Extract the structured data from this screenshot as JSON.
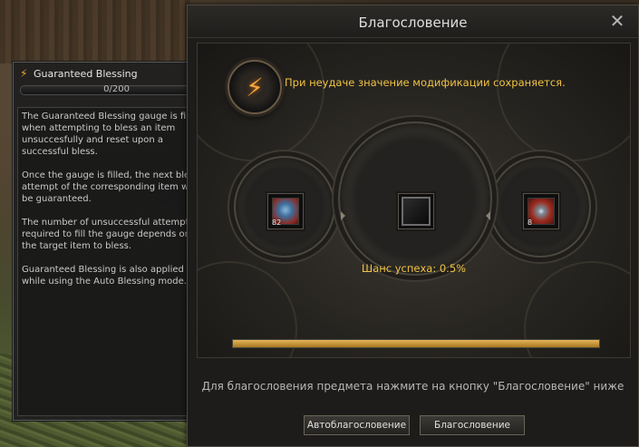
{
  "tooltip": {
    "title": "Guaranteed Blessing",
    "gauge_text": "0/200",
    "gauge_progress": 0,
    "paragraphs": [
      "The Guaranteed Blessing gauge is filled when attempting to bless an item unsuccesfully and reset upon a successful bless.",
      "Once the gauge is filled, the next bless attempt of the corresponding item will be guaranteed.",
      "The number of unsuccessful attempts required to fill the gauge depends on the target item to bless.",
      "Guaranteed Blessing is also applied while using the Auto Blessing mode."
    ]
  },
  "window": {
    "title": "Благословение",
    "close_icon": "close-icon",
    "notice": "При неудаче значение модификации сохраняется.",
    "left_item_count": "82",
    "right_item_count": "8",
    "chance_text": "Шанс успеха: 0.5%",
    "progress": 1.0,
    "instruction": "Для благословения предмета нажмите на кнопку \"Благословение\" ниже",
    "auto_button": "Автоблагословение",
    "bless_button": "Благословение"
  },
  "colors": {
    "accent_gold": "#f0c243",
    "bolt_orange": "#f6a53b",
    "panel_bg": "#1d1c1a"
  }
}
